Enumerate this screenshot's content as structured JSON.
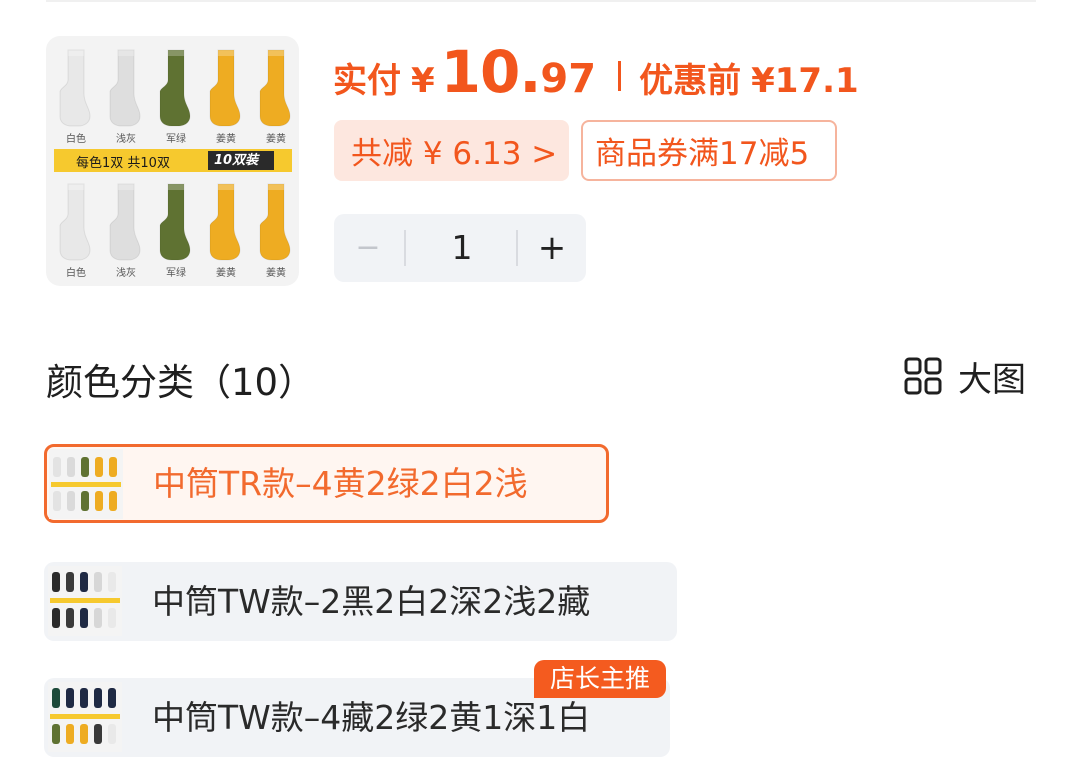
{
  "product": {
    "image": {
      "promo_band_text": "每色1双 共10双",
      "pack_badge": "10双装",
      "row1_labels": [
        "白色",
        "浅灰",
        "军绿",
        "姜黄",
        "姜黄"
      ],
      "row2_labels": [
        "白色",
        "浅灰",
        "军绿",
        "姜黄",
        "姜黄"
      ],
      "sock_colors": {
        "white": "#e8e8e8",
        "light_gray": "#dedede",
        "army_green": "#5f7232",
        "ginger_yellow": "#eeac22"
      }
    }
  },
  "price": {
    "paid_label": "实付",
    "currency": "¥",
    "paid_integer": "10.",
    "paid_decimal": "97",
    "original_label": "优惠前",
    "original_price": "¥17.1",
    "accent_color": "#f2561d"
  },
  "discounts": {
    "total_saving": "共减 ¥ 6.13 >",
    "coupon": "商品券满17减5"
  },
  "quantity": {
    "minus": "−",
    "value": "1",
    "plus": "+"
  },
  "variants_section": {
    "title": "颜色分类（10）",
    "big_image_label": "大图",
    "big_image_icon": "grid-icon",
    "items": [
      {
        "label": "中筒TR款–4黄2绿2白2浅",
        "selected": true
      },
      {
        "label": "中筒TW款–2黑2白2深2浅2藏",
        "selected": false
      },
      {
        "label": "中筒TW款–4藏2绿2黄1深1白",
        "selected": false,
        "badge": "店长主推"
      }
    ]
  }
}
